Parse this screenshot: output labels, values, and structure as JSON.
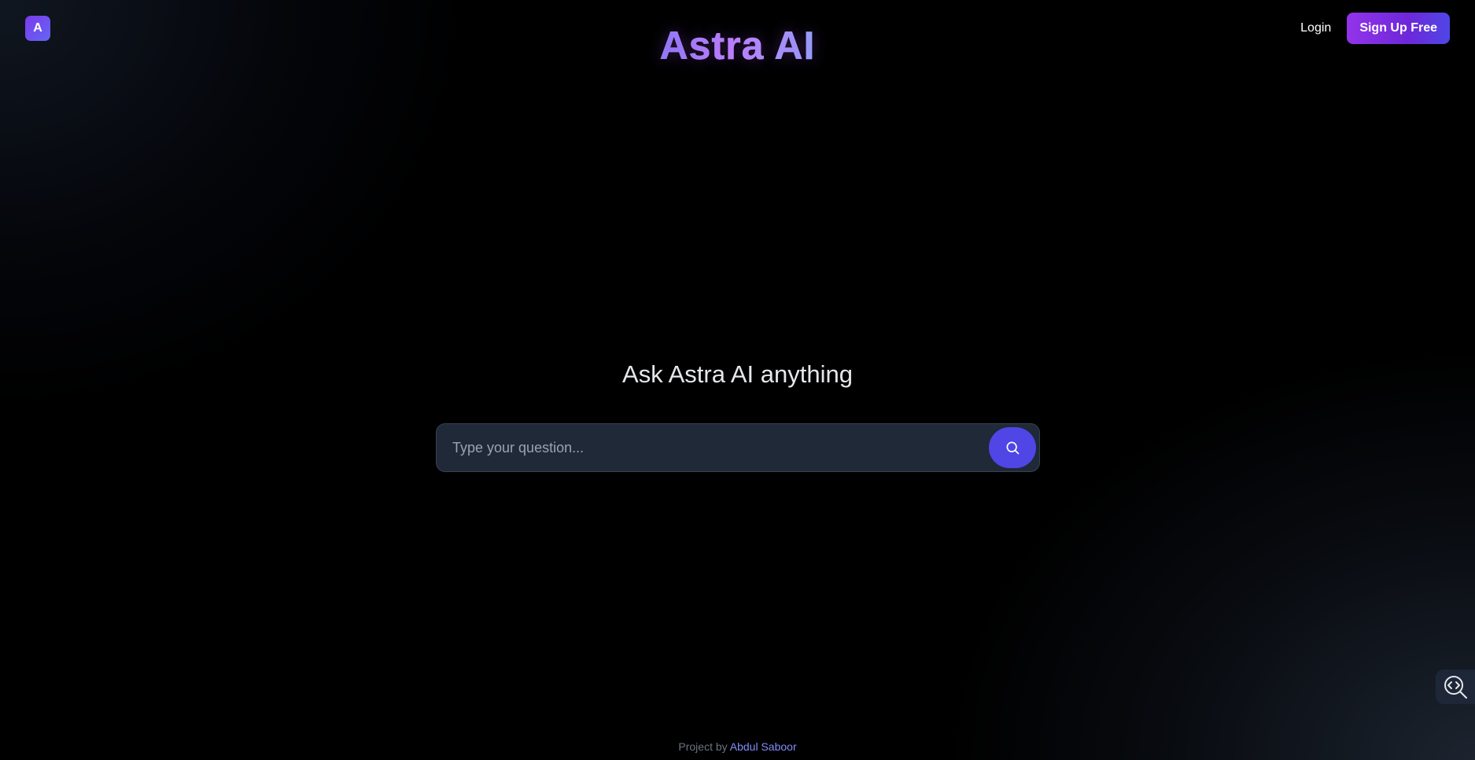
{
  "header": {
    "logo_letter": "A",
    "brand_title": "Astra AI",
    "login_label": "Login",
    "signup_label": "Sign Up Free"
  },
  "main": {
    "heading": "Ask Astra AI anything",
    "search": {
      "placeholder": "Type your question...",
      "value": "",
      "button_icon": "search-icon"
    }
  },
  "footer": {
    "prefix": "Project by",
    "author": "Abdul Saboor"
  },
  "dev_tool": {
    "icon": "code-inspect-icon"
  },
  "colors": {
    "accent": "#4f46e5",
    "brand_gradient_start": "#9333ea",
    "brand_gradient_end": "#4f46e5",
    "link": "#818cf8",
    "input_bg": "#1f2937",
    "background": "#000000"
  }
}
